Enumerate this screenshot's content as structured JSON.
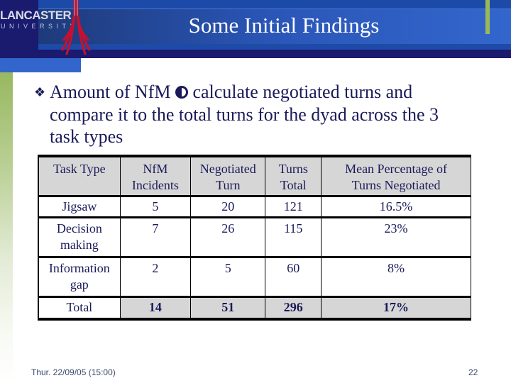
{
  "header": {
    "logo_line1": "LANCASTER",
    "logo_line2": "UNIVERSITY",
    "title": "Some Initial Findings"
  },
  "bullet": {
    "bullet_icon": "diamond-cluster-icon",
    "line1_prefix": "Amount of NfM",
    "inline_icon": "yin-yang-icon",
    "line1_suffix": "calculate negotiated turns and",
    "line2": "compare it to the total turns for the dyad across the 3",
    "line3": "task types"
  },
  "table": {
    "headers": [
      [
        "Task Type"
      ],
      [
        "NfM",
        "Incidents"
      ],
      [
        "Negotiated",
        "Turn"
      ],
      [
        "Turns",
        "Total"
      ],
      [
        "Mean Percentage of",
        "Turns Negotiated"
      ]
    ],
    "rows": [
      {
        "task": [
          "Jigsaw"
        ],
        "nfm": "5",
        "negotiated": "20",
        "total": "121",
        "percent": "16.5%"
      },
      {
        "task": [
          "Decision",
          "making"
        ],
        "nfm": "7",
        "negotiated": "26",
        "total": "115",
        "percent": "23%"
      },
      {
        "task": [
          "Information",
          "gap"
        ],
        "nfm": "2",
        "negotiated": "5",
        "total": "60",
        "percent": "8%"
      }
    ],
    "total_row": {
      "label": "Total",
      "nfm": "14",
      "negotiated": "51",
      "total": "296",
      "percent": "17%"
    }
  },
  "footer": {
    "date": "Thur. 22/09/05 (15:00)",
    "page_number": "22"
  },
  "colors": {
    "header_dark": "#1a1a6e",
    "header_band": "#3366cc",
    "accent_green": "#9ab858",
    "text_navy": "#1a1a5a",
    "crest_red": "#c8102e",
    "table_shade": "#d6d6d6"
  }
}
